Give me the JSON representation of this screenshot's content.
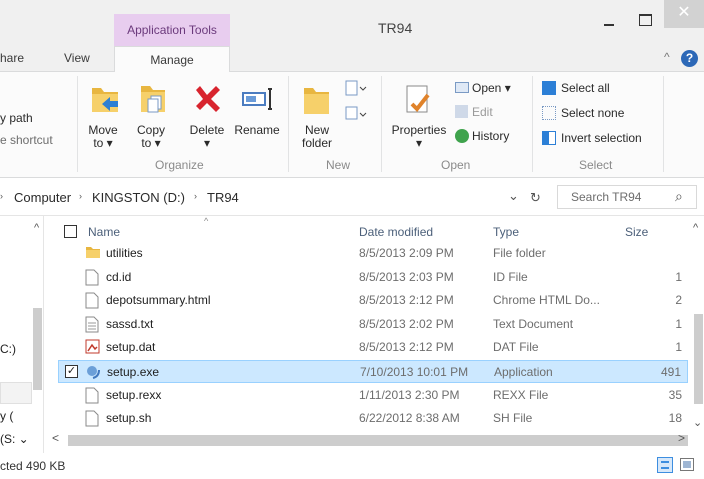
{
  "window": {
    "title": "TR94",
    "context_tab_header": "Application Tools",
    "minimize_glyph": "–",
    "close_glyph": "✕"
  },
  "tabs": {
    "share": "hare",
    "view": "View",
    "manage": "Manage",
    "collapse_glyph": "^",
    "help_glyph": "?"
  },
  "ribbon": {
    "clipboard_partial": {
      "path_label": "y path",
      "shortcut_label": "e shortcut"
    },
    "organize": {
      "move_to_line1": "Move",
      "move_to_line2": "to ▾",
      "copy_to_line1": "Copy",
      "copy_to_line2": "to ▾",
      "delete_label": "Delete",
      "delete_arrow": "▾",
      "rename_label": "Rename",
      "group_label": "Organize"
    },
    "new": {
      "new_folder_line1": "New",
      "new_folder_line2": "folder",
      "group_label": "New"
    },
    "open": {
      "properties_label": "Properties",
      "properties_arrow": "▾",
      "open_label": "Open ▾",
      "edit_label": "Edit",
      "history_label": "History",
      "group_label": "Open"
    },
    "select": {
      "select_all": "Select all",
      "select_none": "Select none",
      "invert_selection": "Invert selection",
      "group_label": "Select"
    }
  },
  "address": {
    "crumbs": [
      "Computer",
      "KINGSTON (D:)",
      "TR94"
    ],
    "separator": "›",
    "dropdown_glyph": "⌄",
    "refresh_glyph": "↻",
    "search_placeholder": "Search TR94",
    "search_glyph": "⌕"
  },
  "nav": {
    "drive_partial": "C:)",
    "item_partial_1": "y (",
    "item_partial_2": "(S: ⌄",
    "scroll_up": "^"
  },
  "columns": {
    "name": "Name",
    "date_modified": "Date modified",
    "type": "Type",
    "size": "Size",
    "sort_glyph": "^"
  },
  "files": [
    {
      "name": "utilities",
      "date": "8/5/2013 2:09 PM",
      "type": "File folder",
      "size": "",
      "icon": "folder-icon",
      "selected": false
    },
    {
      "name": "cd.id",
      "date": "8/5/2013 2:03 PM",
      "type": "ID File",
      "size": "1",
      "icon": "file-icon",
      "selected": false
    },
    {
      "name": "depotsummary.html",
      "date": "8/5/2013 2:12 PM",
      "type": "Chrome HTML Do...",
      "size": "2",
      "icon": "file-icon",
      "selected": false
    },
    {
      "name": "sassd.txt",
      "date": "8/5/2013 2:02 PM",
      "type": "Text Document",
      "size": "1",
      "icon": "text-file-icon",
      "selected": false
    },
    {
      "name": "setup.dat",
      "date": "8/5/2013 2:12 PM",
      "type": "DAT File",
      "size": "1",
      "icon": "dat-file-icon",
      "selected": false
    },
    {
      "name": "setup.exe",
      "date": "7/10/2013 10:01 PM",
      "type": "Application",
      "size": "491",
      "icon": "application-icon",
      "selected": true
    },
    {
      "name": "setup.rexx",
      "date": "1/11/2013 2:30 PM",
      "type": "REXX File",
      "size": "35",
      "icon": "file-icon",
      "selected": false
    },
    {
      "name": "setup.sh",
      "date": "6/22/2012 8:38 AM",
      "type": "SH File",
      "size": "18",
      "icon": "file-icon",
      "selected": false
    }
  ],
  "scroll": {
    "left_glyph": "<",
    "right_glyph": ">",
    "up_glyph": "^",
    "down_glyph": "⌄"
  },
  "status": {
    "text": "cted 490 KB"
  },
  "colors": {
    "context_tab_bg": "#e8cdef",
    "selection_bg": "#cce8ff",
    "accent_blue": "#2c68b7"
  }
}
